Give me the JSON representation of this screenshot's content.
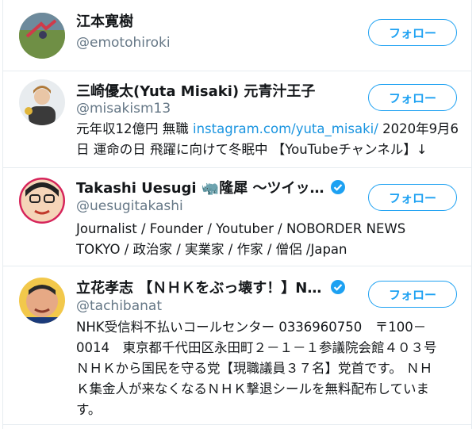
{
  "users": [
    {
      "name": "江本寛樹",
      "handle": "@emotohiroki",
      "follow_label": "フォロー",
      "verified": false,
      "bio_lines": []
    },
    {
      "name": "三崎優太(Yuta Misaki) 元青汁王子",
      "handle": "@misakism13",
      "follow_label": "フォロー",
      "verified": false,
      "bio_prefix": "元年収12億円 無職 ",
      "bio_link": "instagram.com/yuta_misaki/",
      "bio_suffix": " 2020年9月6",
      "bio_line2": "日 運命の日 飛躍に向けて冬眠中 【YouTubeチャンネル】↓"
    },
    {
      "name": "Takashi Uesugi 🦏隆犀 〜ツイッター…",
      "handle": "@uesugitakashi",
      "follow_label": "フォロー",
      "verified": true,
      "bio_line1": "Journalist / Founder / Youtuber / NOBORDER NEWS",
      "bio_line2": "TOKYO / 政治家 / 実業家 / 作家 / 僧侶 /Japan"
    },
    {
      "name": "立花孝志 【ＮＨＫをぶっ壊す！】NH…",
      "handle": "@tachibanat",
      "follow_label": "フォロー",
      "verified": true,
      "bio_line1": "NHK受信料不払いコールセンター 0336960750　〒100－",
      "bio_line2": "0014　東京都千代田区永田町２－１－１参議院会館４０３号",
      "bio_line3": "ＮＨＫから国民を守る党【現職議員３７名】党首です。 ＮＨ",
      "bio_line4": "Ｋ集金人が来なくなるＮＨＫ撃退シールを無料配布していま",
      "bio_line5": "す。"
    }
  ],
  "colors": {
    "accent": "#1da1f2",
    "link": "#1b95e0",
    "secondary_text": "#657786",
    "divider": "#e6ecf0"
  },
  "icons": {
    "verified": "verified-badge-icon"
  }
}
